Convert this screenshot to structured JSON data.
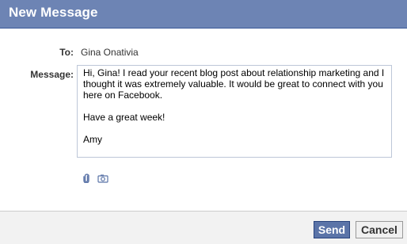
{
  "dialog": {
    "title": "New Message"
  },
  "to": {
    "label": "To:",
    "value": "Gina Onativia"
  },
  "message": {
    "label": "Message:",
    "paragraphs": [
      "Hi, Gina! I read your recent blog post about relationship marketing and I thought it was extremely valuable.  It would be great to connect with you here on Facebook.",
      "Have a great week!",
      "Amy"
    ]
  },
  "attachments": {
    "icons": [
      "paperclip-icon",
      "camera-icon"
    ]
  },
  "buttons": {
    "send_label": "Send",
    "cancel_label": "Cancel"
  },
  "colors": {
    "titlebar": "#6d84b4",
    "send_button": "#5b74a8",
    "input_border": "#bdc7d8"
  }
}
